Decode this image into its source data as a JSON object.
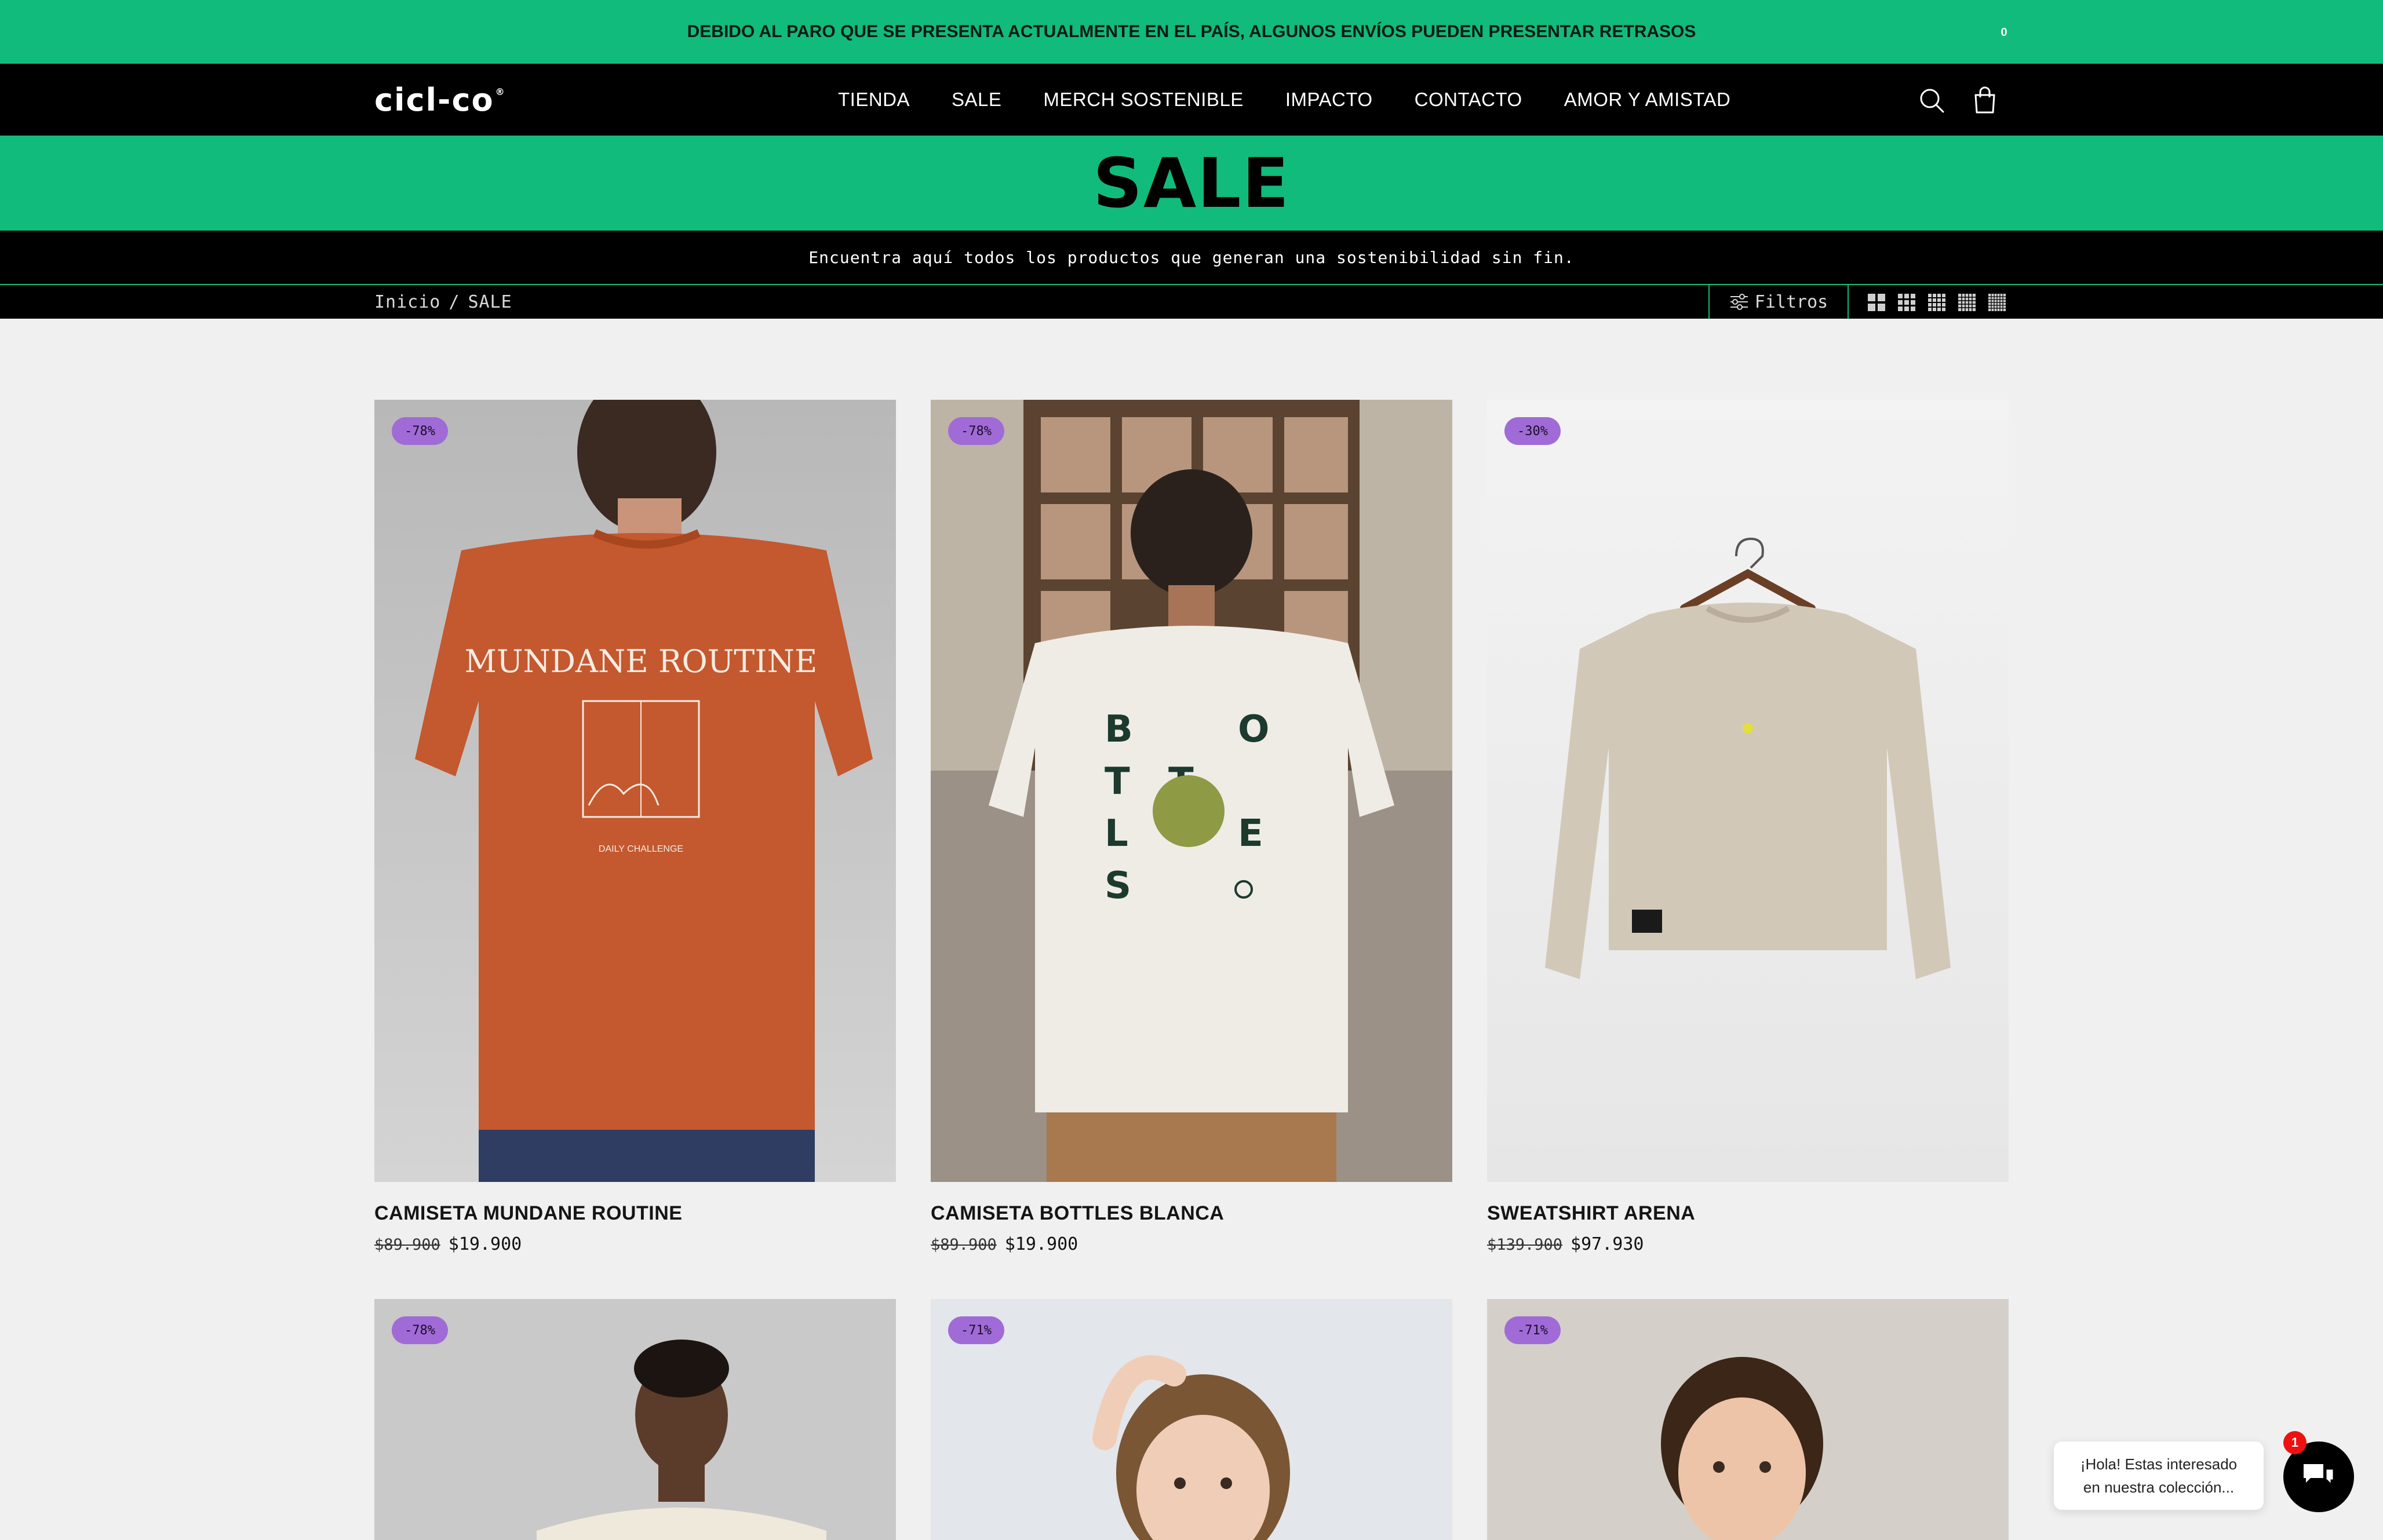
{
  "announcement": "DEBIDO AL PARO QUE SE PRESENTA ACTUALMENTE EN EL PAÍS, ALGUNOS ENVÍOS PUEDEN PRESENTAR RETRASOS",
  "header": {
    "logo": "cicl-co",
    "nav": [
      "TIENDA",
      "SALE",
      "MERCH SOSTENIBLE",
      "IMPACTO",
      "CONTACTO",
      "AMOR Y AMISTAD"
    ],
    "cart_count": "0",
    "icons": {
      "search": "search-icon",
      "cart": "shopping-bag-icon"
    }
  },
  "hero": {
    "title": "SALE",
    "subtitle": "Encuentra aquí todos los productos que generan una sostenibilidad sin fin."
  },
  "toolbar": {
    "breadcrumb": [
      "Inicio",
      "SALE"
    ],
    "breadcrumb_sep": "/",
    "filters_label": "Filtros"
  },
  "products": [
    {
      "badge": "-78%",
      "title": "CAMISETA MUNDANE ROUTINE",
      "old_price": "$89.900",
      "price": "$19.900",
      "print_text": "MUNDANE ROUTINE",
      "print_sub": "DAILY CHALLENGE"
    },
    {
      "badge": "-78%",
      "title": "CAMISETA BOTTLES BLANCA",
      "old_price": "$89.900",
      "price": "$19.900"
    },
    {
      "badge": "-30%",
      "title": "SWEATSHIRT ARENA",
      "old_price": "$139.900",
      "price": "$97.930"
    },
    {
      "badge": "-78%"
    },
    {
      "badge": "-71%"
    },
    {
      "badge": "-71%"
    }
  ],
  "chat": {
    "line1": "¡Hola! Estas interesado",
    "line2": "en nuestra colección...",
    "notification": "1"
  },
  "colors": {
    "accent": "#11bb7c",
    "badge": "#a06bd6",
    "dark": "#000000"
  }
}
